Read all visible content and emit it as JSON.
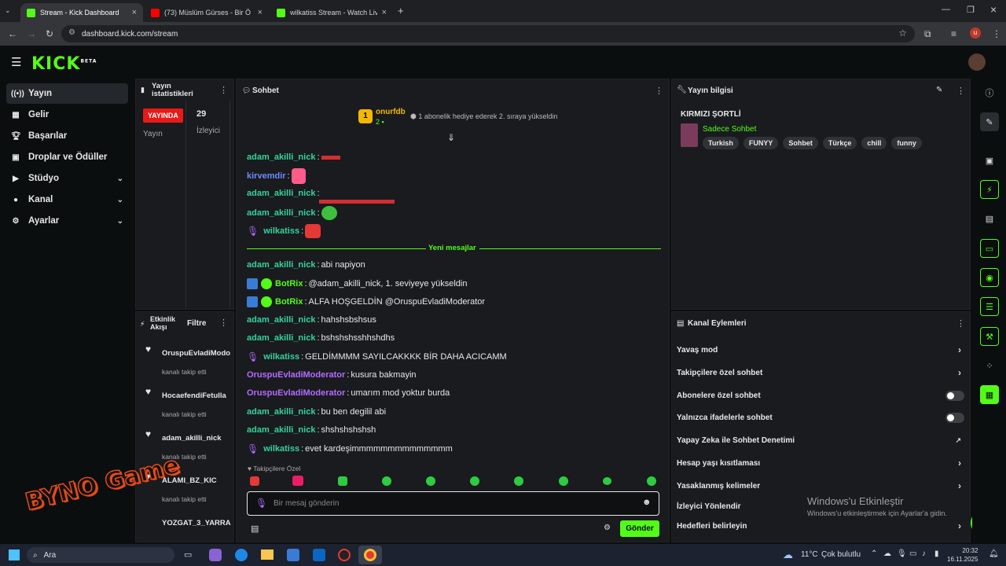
{
  "browser": {
    "tabs": [
      {
        "title": "Stream - Kick Dashboard",
        "color": "#53fc18"
      },
      {
        "title": "(73) Müslüm Gürses - Bir Ö",
        "color": "#ff0000"
      },
      {
        "title": "wilkatiss Stream - Watch Live o",
        "color": "#53fc18"
      }
    ],
    "url": "dashboard.kick.com/stream"
  },
  "brand": "KICK",
  "brand_sup": "BETA",
  "sidebar": {
    "items": [
      {
        "label": "Yayın",
        "icon": "broadcast-icon"
      },
      {
        "label": "Gelir",
        "icon": "chart-icon"
      },
      {
        "label": "Başarılar",
        "icon": "trophy-icon"
      },
      {
        "label": "Droplar ve Ödüller",
        "icon": "gift-icon"
      },
      {
        "label": "Stüdyo",
        "icon": "video-icon"
      },
      {
        "label": "Kanal",
        "icon": "user-icon"
      },
      {
        "label": "Ayarlar",
        "icon": "gear-icon"
      }
    ]
  },
  "stats": {
    "title_line1": "Yayın",
    "title_line2": "istatistikleri",
    "live": "YAYINDA",
    "live_label": "Yayın",
    "viewers": "29",
    "viewers_label": "İzleyici"
  },
  "activity": {
    "title_line1": "Etkinlik",
    "title_line2": "Akışı",
    "filter": "Filtre",
    "items": [
      {
        "name": "OruspuEvladiModo",
        "action": "kanalı takip etti"
      },
      {
        "name": "HocaefendiFetulla",
        "action": "kanalı takip etti"
      },
      {
        "name": "adam_akilli_nick",
        "action": "kanalı takip etti"
      },
      {
        "name": "ALAMI_BZ_KIC",
        "action": "kanalı takip etti"
      },
      {
        "name": "YOZGAT_3_YARRA",
        "action": ""
      }
    ]
  },
  "chat": {
    "title": "Sohbet",
    "pinned": {
      "user": "onurfdb",
      "count": "2",
      "text": "1 abonelik hediye ederek 2. sıraya yükseldin"
    },
    "old": [
      {
        "user": "adam_akilli_nick",
        "cls": "ug",
        "text": ""
      },
      {
        "user": "kirvemdir",
        "cls": "uv",
        "text": ""
      },
      {
        "user": "adam_akilli_nick",
        "cls": "ug",
        "text": ""
      },
      {
        "user": "adam_akilli_nick",
        "cls": "ug",
        "text": ""
      },
      {
        "user": "wilkatiss",
        "cls": "ug",
        "text": "",
        "mic": true
      }
    ],
    "divider": "Yeni mesajlar",
    "messages": [
      {
        "user": "adam_akilli_nick",
        "cls": "ug",
        "text": "abi napiyon"
      },
      {
        "user": "BotRix",
        "cls": "g",
        "text": "@adam_akilli_nick, 1. seviyeye yükseldin",
        "bot": true
      },
      {
        "user": "BotRix",
        "cls": "g",
        "text": "ALFA HOŞGELDİN @OruspuEvladiModerator",
        "bot": true
      },
      {
        "user": "adam_akilli_nick",
        "cls": "ug",
        "text": "hahshsbshsus"
      },
      {
        "user": "adam_akilli_nick",
        "cls": "ug",
        "text": "bshshshsshhshdhs"
      },
      {
        "user": "wilkatiss",
        "cls": "ug",
        "text": "GELDİMMMM SAYILCAKKKK BİR DAHA ACICAMM",
        "mic": true
      },
      {
        "user": "OruspuEvladiModerator",
        "cls": "up",
        "text": "kusura bakmayin"
      },
      {
        "user": "OruspuEvladiModerator",
        "cls": "up",
        "text": "umarım mod yoktur burda"
      },
      {
        "user": "adam_akilli_nick",
        "cls": "ug",
        "text": "bu ben degilil abi"
      },
      {
        "user": "adam_akilli_nick",
        "cls": "ug",
        "text": "shshshshshsh"
      },
      {
        "user": "wilkatiss",
        "cls": "ug",
        "text": "evet kardeşimmmmmmmmmmmmmm",
        "mic": true
      }
    ],
    "followers_only": "Takipçilere Özel",
    "placeholder": "Bir mesaj gönderin",
    "send": "Gönder"
  },
  "streaminfo": {
    "title": "Yayın bilgisi",
    "stream_title": "KIRMIZI ŞORTLİ",
    "category": "Sadece Sohbet",
    "tags": [
      "Turkish",
      "FUNYY",
      "Sohbet",
      "Türkçe",
      "chill",
      "funny"
    ]
  },
  "actions": {
    "title": "Kanal Eylemleri",
    "items": [
      {
        "label": "Yavaş mod",
        "ctrl": "chevron"
      },
      {
        "label": "Takipçilere özel sohbet",
        "ctrl": "chevron"
      },
      {
        "label": "Abonelere özel sohbet",
        "ctrl": "toggle"
      },
      {
        "label": "Yalnızca ifadelerle sohbet",
        "ctrl": "toggle"
      },
      {
        "label": "Yapay Zeka ile Sohbet Denetimi",
        "ctrl": "external"
      },
      {
        "label": "Hesap yaşı kısıtlaması",
        "ctrl": "chevron"
      },
      {
        "label": "Yasaklanmış kelimeler",
        "ctrl": "chevron"
      },
      {
        "label": "İzleyici Yönlendir",
        "ctrl": ""
      },
      {
        "label": "Hedefleri belirleyin",
        "ctrl": "chevron"
      }
    ]
  },
  "watermark": {
    "line1": "Windows'u Etkinleştir",
    "line2": "Windows'u etkinleştirmek için Ayarlar'a gidin."
  },
  "overlay_logo": "BYNO Game",
  "taskbar": {
    "search": "Ara",
    "weather": "11°C",
    "weather_text": "Çok bulutlu",
    "time": "20:32",
    "date": "16.11.2025"
  }
}
